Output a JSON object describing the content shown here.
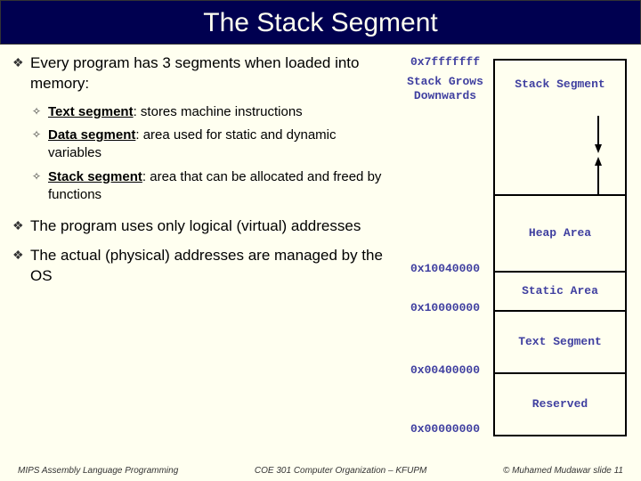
{
  "title": "The Stack Segment",
  "bullets": {
    "b1": "Every program has 3 segments when loaded into memory:",
    "s1a_pre": "Text segment",
    "s1a_post": ": stores machine instructions",
    "s1b_pre": "Data segment",
    "s1b_post": ": area used for static and dynamic variables",
    "s1c_pre": "Stack segment",
    "s1c_post": ": area that can be allocated and freed by functions",
    "b2": "The program uses only logical (virtual) addresses",
    "b3": "The actual (physical) addresses are managed by the OS"
  },
  "addresses": {
    "a0": "0x7fffffff",
    "grows": "Stack Grows Downwards",
    "a1": "0x10040000",
    "a2": "0x10000000",
    "a3": "0x00400000",
    "a4": "0x00000000"
  },
  "segments": {
    "stack": "Stack Segment",
    "heap": "Heap Area",
    "static": "Static Area",
    "text": "Text Segment",
    "reserved": "Reserved"
  },
  "footer": {
    "left": "MIPS Assembly Language Programming",
    "center": "COE 301 Computer Organization – KFUPM",
    "right": "© Muhamed Mudawar   slide 11"
  }
}
